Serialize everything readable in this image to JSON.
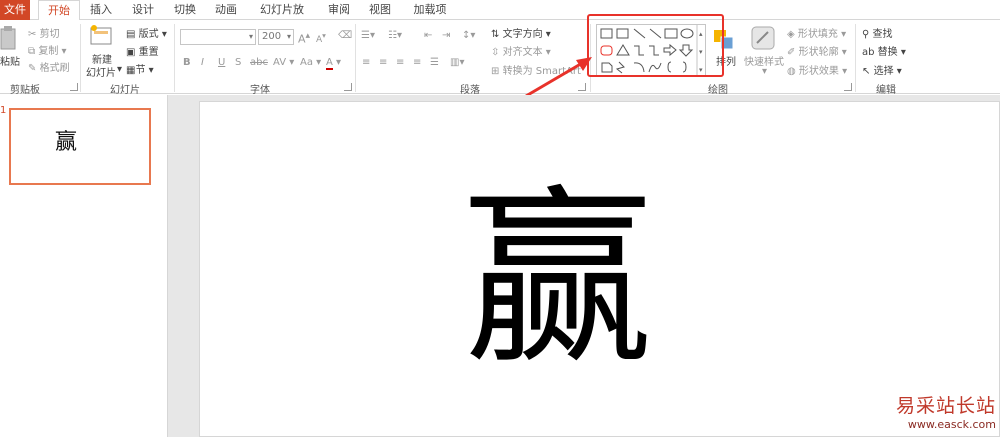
{
  "tabs": {
    "file": "文件",
    "items": [
      "开始",
      "插入",
      "设计",
      "切换",
      "动画",
      "幻灯片放映",
      "审阅",
      "视图",
      "加载项"
    ]
  },
  "clipboard": {
    "paste": "粘贴",
    "cut": "剪切",
    "copy": "复制",
    "format_painter": "格式刷",
    "label": "剪贴板"
  },
  "slides_group": {
    "new_slide_line1": "新建",
    "new_slide_line2": "幻灯片",
    "layout": "版式",
    "reset": "重置",
    "section": "节",
    "label": "幻灯片"
  },
  "font": {
    "size_value": "200",
    "bold": "B",
    "italic": "I",
    "underline": "U",
    "strike": "S",
    "strike2": "abc",
    "spacing": "AV",
    "case": "Aa",
    "grow": "A",
    "shrink": "A",
    "color": "A",
    "label": "字体"
  },
  "paragraph": {
    "text_direction": "文字方向",
    "align_text": "对齐文本",
    "convert_smartart": "转换为 SmartArt",
    "label": "段落"
  },
  "drawing": {
    "arrange": "排列",
    "quick_styles": "快速样式",
    "shape_fill": "形状填充",
    "shape_outline": "形状轮廓",
    "shape_effects": "形状效果",
    "label": "绘图"
  },
  "editing": {
    "find": "查找",
    "replace": "替换",
    "select": "选择",
    "label": "编辑"
  },
  "slide_pane": {
    "number": "1",
    "thumb_text": "赢"
  },
  "slide": {
    "text": "赢"
  },
  "watermark": {
    "name": "易采站长站",
    "url": "www.easck.com"
  },
  "colors": {
    "accent": "#d24726",
    "highlight": "#e8322a"
  }
}
